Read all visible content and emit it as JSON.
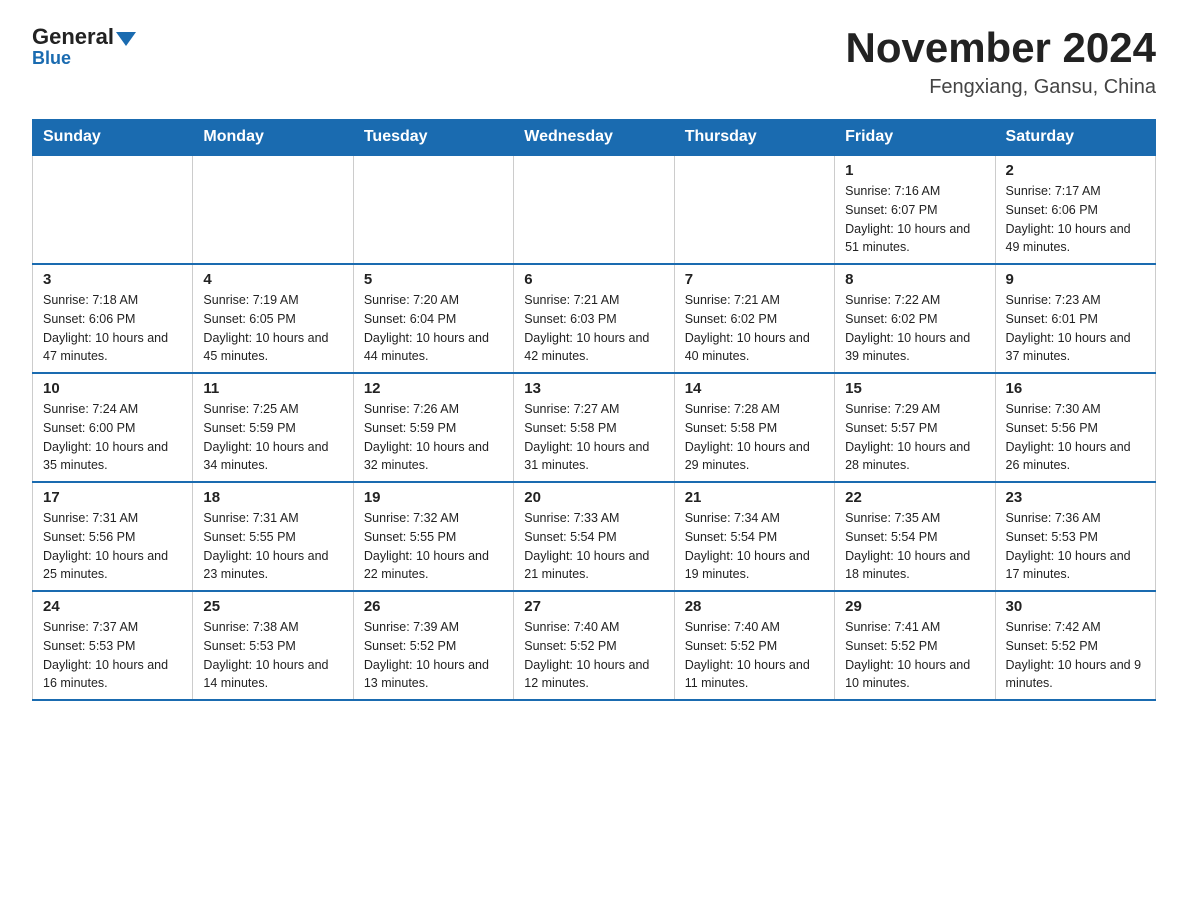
{
  "header": {
    "logo_general": "General",
    "logo_blue": "Blue",
    "month_title": "November 2024",
    "location": "Fengxiang, Gansu, China"
  },
  "weekdays": [
    "Sunday",
    "Monday",
    "Tuesday",
    "Wednesday",
    "Thursday",
    "Friday",
    "Saturday"
  ],
  "weeks": [
    [
      {
        "day": "",
        "info": ""
      },
      {
        "day": "",
        "info": ""
      },
      {
        "day": "",
        "info": ""
      },
      {
        "day": "",
        "info": ""
      },
      {
        "day": "",
        "info": ""
      },
      {
        "day": "1",
        "info": "Sunrise: 7:16 AM\nSunset: 6:07 PM\nDaylight: 10 hours and 51 minutes."
      },
      {
        "day": "2",
        "info": "Sunrise: 7:17 AM\nSunset: 6:06 PM\nDaylight: 10 hours and 49 minutes."
      }
    ],
    [
      {
        "day": "3",
        "info": "Sunrise: 7:18 AM\nSunset: 6:06 PM\nDaylight: 10 hours and 47 minutes."
      },
      {
        "day": "4",
        "info": "Sunrise: 7:19 AM\nSunset: 6:05 PM\nDaylight: 10 hours and 45 minutes."
      },
      {
        "day": "5",
        "info": "Sunrise: 7:20 AM\nSunset: 6:04 PM\nDaylight: 10 hours and 44 minutes."
      },
      {
        "day": "6",
        "info": "Sunrise: 7:21 AM\nSunset: 6:03 PM\nDaylight: 10 hours and 42 minutes."
      },
      {
        "day": "7",
        "info": "Sunrise: 7:21 AM\nSunset: 6:02 PM\nDaylight: 10 hours and 40 minutes."
      },
      {
        "day": "8",
        "info": "Sunrise: 7:22 AM\nSunset: 6:02 PM\nDaylight: 10 hours and 39 minutes."
      },
      {
        "day": "9",
        "info": "Sunrise: 7:23 AM\nSunset: 6:01 PM\nDaylight: 10 hours and 37 minutes."
      }
    ],
    [
      {
        "day": "10",
        "info": "Sunrise: 7:24 AM\nSunset: 6:00 PM\nDaylight: 10 hours and 35 minutes."
      },
      {
        "day": "11",
        "info": "Sunrise: 7:25 AM\nSunset: 5:59 PM\nDaylight: 10 hours and 34 minutes."
      },
      {
        "day": "12",
        "info": "Sunrise: 7:26 AM\nSunset: 5:59 PM\nDaylight: 10 hours and 32 minutes."
      },
      {
        "day": "13",
        "info": "Sunrise: 7:27 AM\nSunset: 5:58 PM\nDaylight: 10 hours and 31 minutes."
      },
      {
        "day": "14",
        "info": "Sunrise: 7:28 AM\nSunset: 5:58 PM\nDaylight: 10 hours and 29 minutes."
      },
      {
        "day": "15",
        "info": "Sunrise: 7:29 AM\nSunset: 5:57 PM\nDaylight: 10 hours and 28 minutes."
      },
      {
        "day": "16",
        "info": "Sunrise: 7:30 AM\nSunset: 5:56 PM\nDaylight: 10 hours and 26 minutes."
      }
    ],
    [
      {
        "day": "17",
        "info": "Sunrise: 7:31 AM\nSunset: 5:56 PM\nDaylight: 10 hours and 25 minutes."
      },
      {
        "day": "18",
        "info": "Sunrise: 7:31 AM\nSunset: 5:55 PM\nDaylight: 10 hours and 23 minutes."
      },
      {
        "day": "19",
        "info": "Sunrise: 7:32 AM\nSunset: 5:55 PM\nDaylight: 10 hours and 22 minutes."
      },
      {
        "day": "20",
        "info": "Sunrise: 7:33 AM\nSunset: 5:54 PM\nDaylight: 10 hours and 21 minutes."
      },
      {
        "day": "21",
        "info": "Sunrise: 7:34 AM\nSunset: 5:54 PM\nDaylight: 10 hours and 19 minutes."
      },
      {
        "day": "22",
        "info": "Sunrise: 7:35 AM\nSunset: 5:54 PM\nDaylight: 10 hours and 18 minutes."
      },
      {
        "day": "23",
        "info": "Sunrise: 7:36 AM\nSunset: 5:53 PM\nDaylight: 10 hours and 17 minutes."
      }
    ],
    [
      {
        "day": "24",
        "info": "Sunrise: 7:37 AM\nSunset: 5:53 PM\nDaylight: 10 hours and 16 minutes."
      },
      {
        "day": "25",
        "info": "Sunrise: 7:38 AM\nSunset: 5:53 PM\nDaylight: 10 hours and 14 minutes."
      },
      {
        "day": "26",
        "info": "Sunrise: 7:39 AM\nSunset: 5:52 PM\nDaylight: 10 hours and 13 minutes."
      },
      {
        "day": "27",
        "info": "Sunrise: 7:40 AM\nSunset: 5:52 PM\nDaylight: 10 hours and 12 minutes."
      },
      {
        "day": "28",
        "info": "Sunrise: 7:40 AM\nSunset: 5:52 PM\nDaylight: 10 hours and 11 minutes."
      },
      {
        "day": "29",
        "info": "Sunrise: 7:41 AM\nSunset: 5:52 PM\nDaylight: 10 hours and 10 minutes."
      },
      {
        "day": "30",
        "info": "Sunrise: 7:42 AM\nSunset: 5:52 PM\nDaylight: 10 hours and 9 minutes."
      }
    ]
  ]
}
